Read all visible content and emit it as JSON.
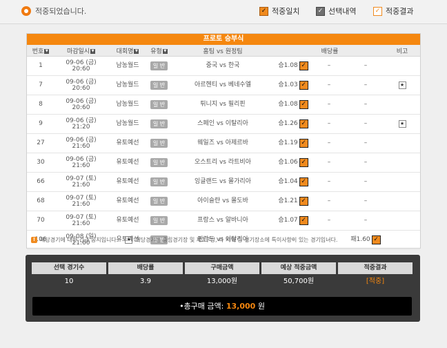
{
  "status": "적중되었습니다.",
  "legend": [
    {
      "label": "적중일치",
      "color": "#f08a1e"
    },
    {
      "label": "선택내역",
      "color": "#707070"
    },
    {
      "label": "적중결과",
      "color": "#f08a1e"
    }
  ],
  "table_title": "프로토 승부식",
  "headers": {
    "no": "번호",
    "deadline": "마감일시",
    "league": "대회명",
    "type": "유형",
    "match": "홈팀 vs 원정팀",
    "odds": "배당률",
    "note": "비고"
  },
  "rows": [
    {
      "no": "1",
      "date": "09-06 (금)",
      "time": "20:60",
      "league": "남농월드",
      "type": "일 반",
      "home": "중국",
      "away": "한국",
      "o1": "승1.08",
      "o2": "–",
      "o3": "–",
      "note": ""
    },
    {
      "no": "7",
      "date": "09-06 (금)",
      "time": "20:60",
      "league": "남농월드",
      "type": "일 반",
      "home": "아르헨티",
      "away": "베네수엘",
      "o1": "승1.03",
      "o2": "–",
      "o3": "–",
      "note": "★"
    },
    {
      "no": "8",
      "date": "09-06 (금)",
      "time": "20:60",
      "league": "남농월드",
      "type": "일 반",
      "home": "튀니지",
      "away": "필리핀",
      "o1": "승1.08",
      "o2": "–",
      "o3": "–",
      "note": ""
    },
    {
      "no": "9",
      "date": "09-06 (금)",
      "time": "21:20",
      "league": "남농월드",
      "type": "일 반",
      "home": "스페인",
      "away": "이탈리아",
      "o1": "승1.26",
      "o2": "–",
      "o3": "–",
      "note": "★"
    },
    {
      "no": "27",
      "date": "09-06 (금)",
      "time": "21:60",
      "league": "유토예선",
      "type": "일 반",
      "home": "웨일즈",
      "away": "아제르바",
      "o1": "승1.19",
      "o2": "–",
      "o3": "–",
      "note": ""
    },
    {
      "no": "30",
      "date": "09-06 (금)",
      "time": "21:60",
      "league": "유토예선",
      "type": "일 반",
      "home": "오스트리",
      "away": "라트비아",
      "o1": "승1.06",
      "o2": "–",
      "o3": "–",
      "note": ""
    },
    {
      "no": "66",
      "date": "09-07 (토)",
      "time": "21:60",
      "league": "유토예선",
      "type": "일 반",
      "home": "잉글랜드",
      "away": "몰가리아",
      "o1": "승1.04",
      "o2": "–",
      "o3": "–",
      "note": ""
    },
    {
      "no": "68",
      "date": "09-07 (토)",
      "time": "21:60",
      "league": "유토예선",
      "type": "일 반",
      "home": "아이슬란",
      "away": "몰도바",
      "o1": "승1.21",
      "o2": "–",
      "o3": "–",
      "note": ""
    },
    {
      "no": "70",
      "date": "09-07 (토)",
      "time": "21:60",
      "league": "유토예선",
      "type": "일 반",
      "home": "프랑스",
      "away": "알바니아",
      "o1": "승1.07",
      "o2": "–",
      "o3": "–",
      "note": ""
    },
    {
      "no": "106",
      "date": "09-08 (일)",
      "time": "21:60",
      "league": "유토예선",
      "type": "일 반",
      "home": "핀란드",
      "away": "이탈리아",
      "o1": "–",
      "o2": "–",
      "o3": "패1.60",
      "note": ""
    }
  ],
  "notes": {
    "urgent": "해당경기에 대한 긴급 공지입니다.",
    "star": "해당경기는 중립경기장 및 제2구장, 타 지역 등 경기장소에 특이사항이 있는 경기입니다."
  },
  "summary": {
    "headers": [
      "선택 경기수",
      "배당률",
      "구매금액",
      "예상 적중금액",
      "적중결과"
    ],
    "values": [
      "10",
      "3.9",
      "13,000원",
      "50,700원",
      "[적중]"
    ],
    "total_label": "•총구매 금액:",
    "total_value": "13,000",
    "total_unit": "원"
  }
}
